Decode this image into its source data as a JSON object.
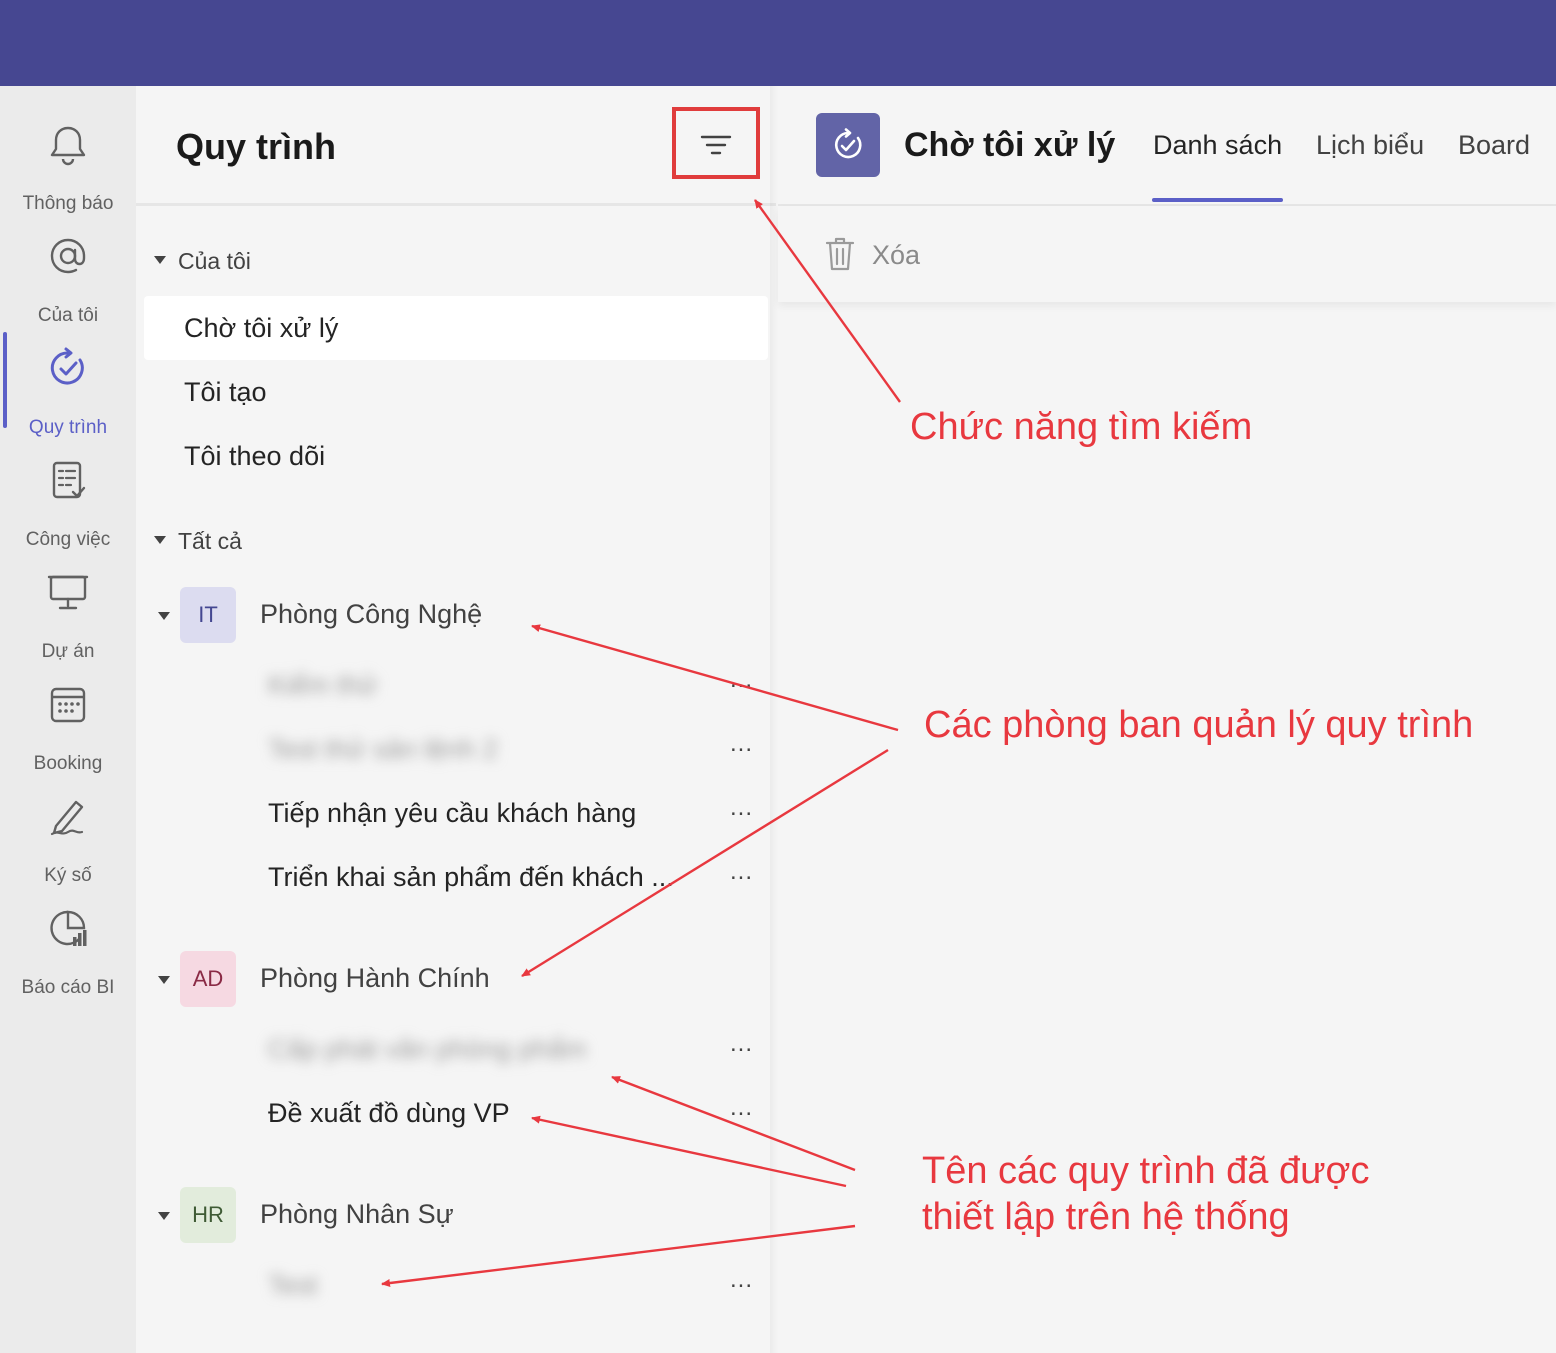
{
  "rail": [
    {
      "label": "Thông báo",
      "icon": "bell-icon"
    },
    {
      "label": "Của tôi",
      "icon": "at-icon"
    },
    {
      "label": "Quy trình",
      "icon": "process-check-icon",
      "active": true
    },
    {
      "label": "Công việc",
      "icon": "task-list-icon"
    },
    {
      "label": "Dự án",
      "icon": "project-board-icon"
    },
    {
      "label": "Booking",
      "icon": "calendar-icon"
    },
    {
      "label": "Ký số",
      "icon": "signature-icon"
    },
    {
      "label": "Báo cáo BI",
      "icon": "bi-report-icon"
    }
  ],
  "panel": {
    "title": "Quy trình",
    "filter_icon": "filter-lines-icon",
    "my_section": "Của tôi",
    "my_items": [
      "Chờ tôi xử lý",
      "Tôi tạo",
      "Tôi theo dõi"
    ],
    "all_section": "Tất cả",
    "departments": [
      {
        "badge": "IT",
        "name": "Phòng Công Nghệ",
        "badge_bg": "#dcdcf0",
        "badge_fg": "#444791",
        "processes": [
          "Kiểm thử",
          "Test thử sản lệnh 2",
          "Tiếp nhận yêu cầu khách hàng",
          "Triển khai sản phẩm đến khách ..."
        ]
      },
      {
        "badge": "AD",
        "name": "Phòng Hành Chính",
        "badge_bg": "#f6d9e2",
        "badge_fg": "#8a2a45",
        "processes": [
          "Cấp phát văn phòng phẩm",
          "Đề xuất đồ dùng VP"
        ]
      },
      {
        "badge": "HR",
        "name": "Phòng Nhân Sự",
        "badge_bg": "#e2ecdc",
        "badge_fg": "#3f5b35",
        "processes": [
          "Test"
        ]
      }
    ],
    "more_label": "..."
  },
  "main": {
    "title": "Chờ tôi xử lý",
    "tabs": [
      "Danh sách",
      "Lịch biểu",
      "Board"
    ],
    "delete_label": "Xóa",
    "delete_icon": "trash-icon"
  },
  "annotations": {
    "search": "Chức năng tìm kiếm",
    "departments": "Các phòng ban quản lý quy trình",
    "processes_line1": "Tên các quy trình đã được",
    "processes_line2": "thiết lập trên hệ thống"
  },
  "colors": {
    "topbar": "#464791",
    "accent": "#5b5fc7",
    "annotation": "#e8383f"
  }
}
